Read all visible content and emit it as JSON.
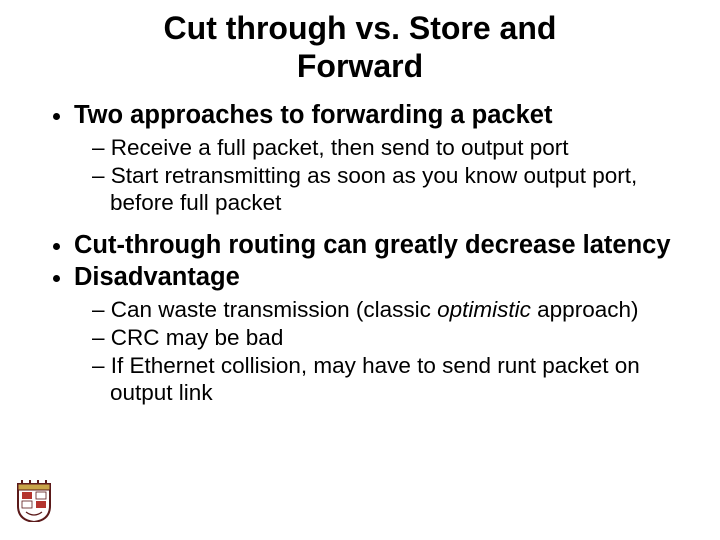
{
  "title_line1": "Cut through vs. Store and",
  "title_line2": "Forward",
  "b1": "Two approaches to forwarding a packet",
  "b1s1": "Receive a full packet, then send to output port",
  "b1s2": "Start retransmitting as soon as you know output port, before full packet",
  "b2": "Cut-through routing can greatly decrease latency",
  "b3": "Disadvantage",
  "b3s1a": "Can waste transmission (classic ",
  "b3s1b": "optimistic",
  "b3s1c": " approach)",
  "b3s2": "CRC may be bad",
  "b3s3": "If Ethernet collision, may have to send runt packet on output link"
}
